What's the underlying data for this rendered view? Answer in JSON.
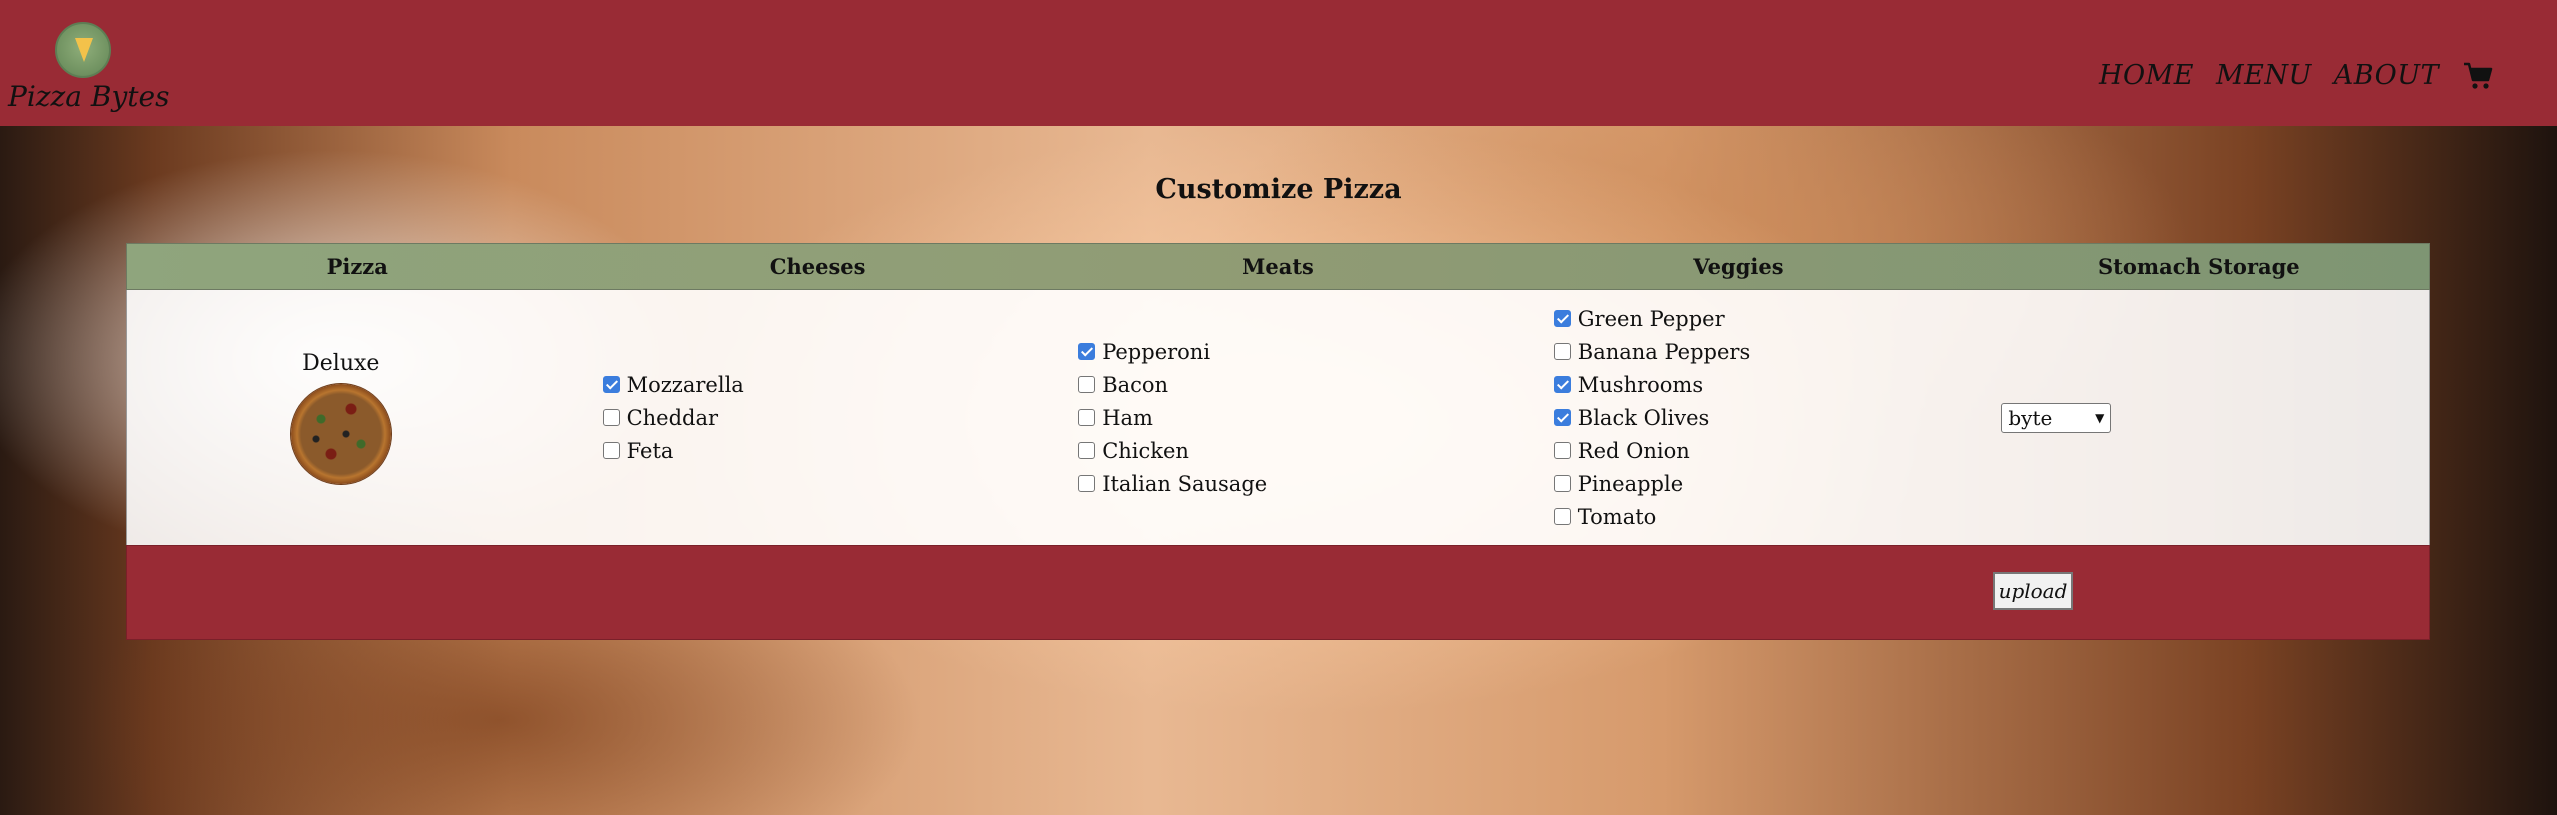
{
  "brand": {
    "name": "Pizza Bytes",
    "logo_icon": "pizza-logo-icon"
  },
  "nav": {
    "items": [
      {
        "label": "HOME"
      },
      {
        "label": "MENU"
      },
      {
        "label": "ABOUT"
      }
    ],
    "cart_icon": "cart-icon"
  },
  "page": {
    "title": "Customize Pizza"
  },
  "table": {
    "headers": [
      "Pizza",
      "Cheeses",
      "Meats",
      "Veggies",
      "Stomach Storage"
    ],
    "pizza": {
      "name": "Deluxe",
      "image_icon": "pizza-image"
    },
    "cheeses": [
      {
        "label": "Mozzarella",
        "checked": true
      },
      {
        "label": "Cheddar",
        "checked": false
      },
      {
        "label": "Feta",
        "checked": false
      }
    ],
    "meats": [
      {
        "label": "Pepperoni",
        "checked": true
      },
      {
        "label": "Bacon",
        "checked": false
      },
      {
        "label": "Ham",
        "checked": false
      },
      {
        "label": "Chicken",
        "checked": false
      },
      {
        "label": "Italian Sausage",
        "checked": false
      }
    ],
    "veggies": [
      {
        "label": "Green Pepper",
        "checked": true
      },
      {
        "label": "Banana Peppers",
        "checked": false
      },
      {
        "label": "Mushrooms",
        "checked": true
      },
      {
        "label": "Black Olives",
        "checked": true
      },
      {
        "label": "Red Onion",
        "checked": false
      },
      {
        "label": "Pineapple",
        "checked": false
      },
      {
        "label": "Tomato",
        "checked": false
      }
    ],
    "storage": {
      "selected": "byte"
    }
  },
  "footer": {
    "upload_label": "upload"
  },
  "colors": {
    "navbar": "#992b35",
    "table_header": "#8fa57d",
    "checkbox_checked": "#3b7ddd"
  }
}
